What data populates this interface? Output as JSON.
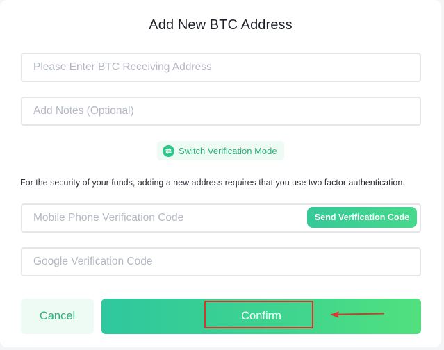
{
  "dialog": {
    "title": "Add New BTC Address"
  },
  "fields": {
    "address": {
      "placeholder": "Please Enter BTC Receiving Address",
      "value": ""
    },
    "notes": {
      "placeholder": "Add Notes (Optional)",
      "value": ""
    },
    "mobile_code": {
      "placeholder": "Mobile Phone Verification Code",
      "value": ""
    },
    "google_code": {
      "placeholder": "Google Verification Code",
      "value": ""
    }
  },
  "switch_mode": {
    "label": "Switch Verification Mode",
    "icon": "swap-icon"
  },
  "security_note": "For the security of your funds, adding a new address requires that you use two factor authentication.",
  "send_code": {
    "label": "Send Verification Code"
  },
  "actions": {
    "cancel_label": "Cancel",
    "confirm_label": "Confirm"
  },
  "annotation": {
    "highlight_color": "#e0322a",
    "arrow_color": "#e0322a"
  },
  "colors": {
    "accent": "#2fc48a",
    "accent_light": "#eefaf4",
    "text": "#1f2229",
    "placeholder": "#b3b8c2",
    "border": "#e4e6ea"
  }
}
